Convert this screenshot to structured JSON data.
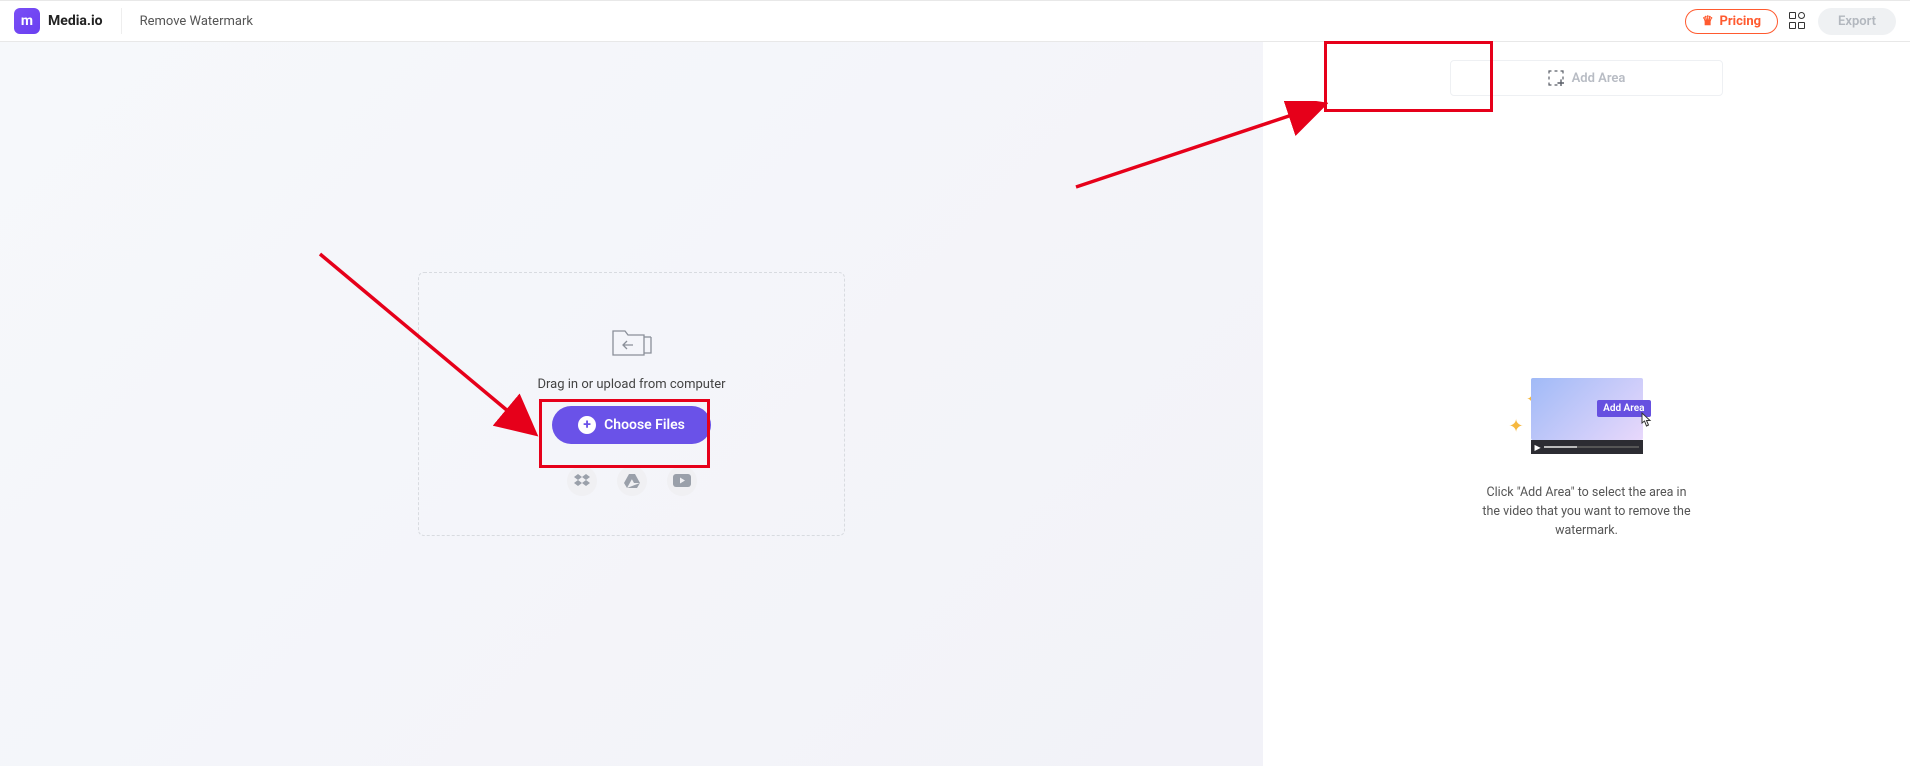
{
  "header": {
    "brand": "Media.io",
    "page_title": "Remove Watermark",
    "pricing_label": "Pricing",
    "export_label": "Export"
  },
  "upload": {
    "hint": "Drag in or upload from computer",
    "choose_label": "Choose Files"
  },
  "sidebar": {
    "add_area_label": "Add Area",
    "preview_badge": "Add Area",
    "help_text": "Click \"Add Area\" to select the area in the video that you want to remove the watermark."
  }
}
